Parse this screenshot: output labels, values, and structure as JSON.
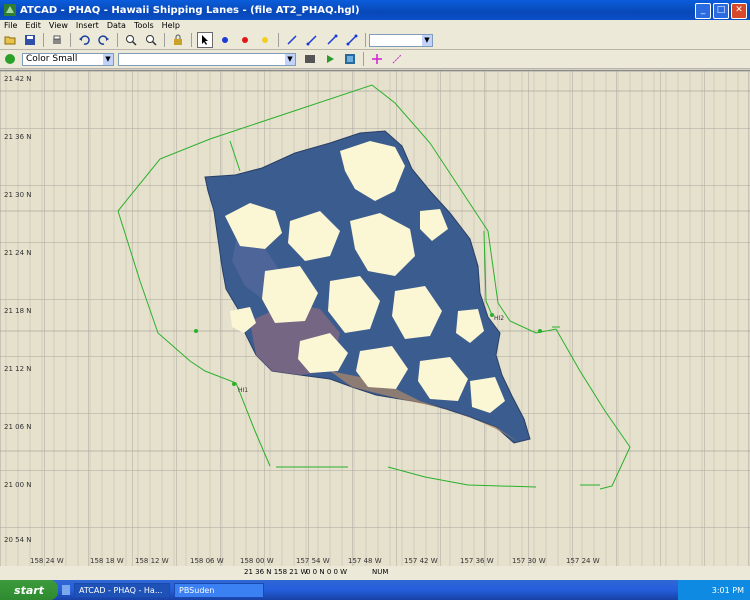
{
  "window": {
    "title": "ATCAD - PHAQ - Hawaii Shipping Lanes - (file AT2_PHAQ.hgl)",
    "controls": [
      "_",
      "□",
      "✕"
    ]
  },
  "menu": [
    "File",
    "Edit",
    "View",
    "Insert",
    "Data",
    "Tools",
    "Help"
  ],
  "toolbar1": {
    "buttons": [
      "open-folder",
      "save",
      "print",
      "undo",
      "redo",
      "zoom-in",
      "zoom-out",
      "lock",
      "select-arrow",
      "blue-point",
      "red-point",
      "yellow-point",
      "line-1",
      "line-2",
      "line-3",
      "line-4"
    ],
    "dropdown_value": ""
  },
  "toolbar2": {
    "layer_value": "Color Small",
    "second_value": ""
  },
  "map": {
    "y_labels": [
      "21 42 N",
      "21 36 N",
      "21 30 N",
      "21 24 N",
      "21 18 N",
      "21 12 N",
      "21 06 N",
      "21 00 N",
      "20 54 N"
    ],
    "x_labels": [
      "158 24 W",
      "158 18 W",
      "158 12 W",
      "158 06 W",
      "158 00 W",
      "157 54 W",
      "157 48 W",
      "157 42 W",
      "157 36 W",
      "157 30 W",
      "157 24 W"
    ],
    "point_labels": [
      "HI1",
      "HI2"
    ],
    "colors": {
      "background": "#e6e1cd",
      "grid": "#a8a7a0",
      "lane": "#2ab02a",
      "island_dark": "#3a5a8c",
      "cloud": "#fbf6d4"
    }
  },
  "status": {
    "left": "21 36 N  158 21 W",
    "mid": "0 0 N  0 0 W",
    "right": "NUM"
  },
  "taskbar": {
    "start": "start",
    "items": [
      "ATCAD - PHAQ - Ha...",
      "PBSuden"
    ],
    "clock": "3:01 PM"
  }
}
